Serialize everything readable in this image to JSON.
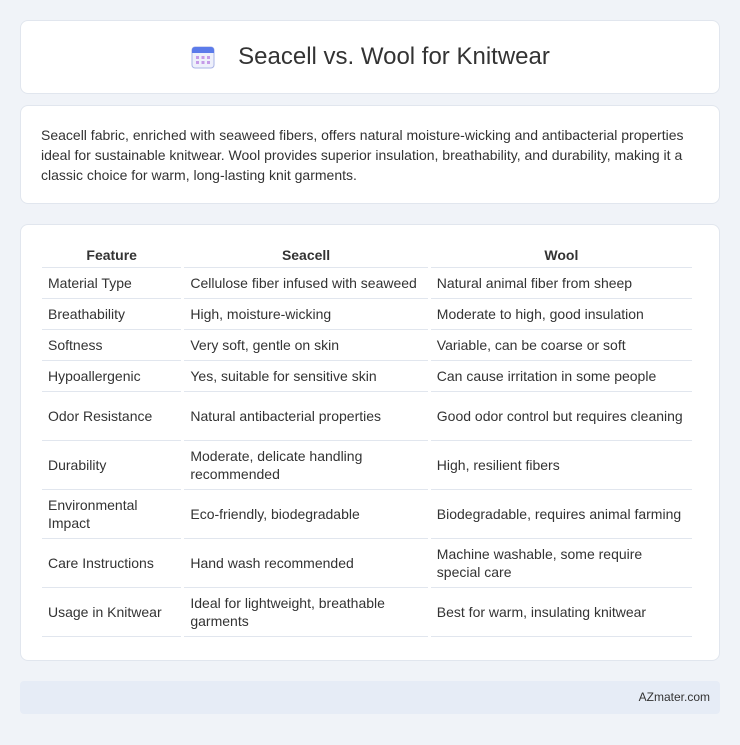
{
  "header": {
    "title": "Seacell vs. Wool for Knitwear",
    "icon": "calendar-icon"
  },
  "description": "Seacell fabric, enriched with seaweed fibers, offers natural moisture-wicking and antibacterial properties ideal for sustainable knitwear. Wool provides superior insulation, breathability, and durability, making it a classic choice for warm, long-lasting knit garments.",
  "table": {
    "columns": [
      "Feature",
      "Seacell",
      "Wool"
    ],
    "rows": [
      [
        "Material Type",
        "Cellulose fiber infused with seaweed",
        "Natural animal fiber from sheep"
      ],
      [
        "Breathability",
        "High, moisture-wicking",
        "Moderate to high, good insulation"
      ],
      [
        "Softness",
        "Very soft, gentle on skin",
        "Variable, can be coarse or soft"
      ],
      [
        "Hypoallergenic",
        "Yes, suitable for sensitive skin",
        "Can cause irritation in some people"
      ],
      [
        "Odor Resistance",
        "Natural antibacterial properties",
        "Good odor control but requires cleaning"
      ],
      [
        "Durability",
        "Moderate, delicate handling recommended",
        "High, resilient fibers"
      ],
      [
        "Environmental Impact",
        "Eco-friendly, biodegradable",
        "Biodegradable, requires animal farming"
      ],
      [
        "Care Instructions",
        "Hand wash recommended",
        "Machine washable, some require special care"
      ],
      [
        "Usage in Knitwear",
        "Ideal for lightweight, breathable garments",
        "Best for warm, insulating knitwear"
      ]
    ]
  },
  "footer": {
    "brand": "AZmater.com"
  }
}
